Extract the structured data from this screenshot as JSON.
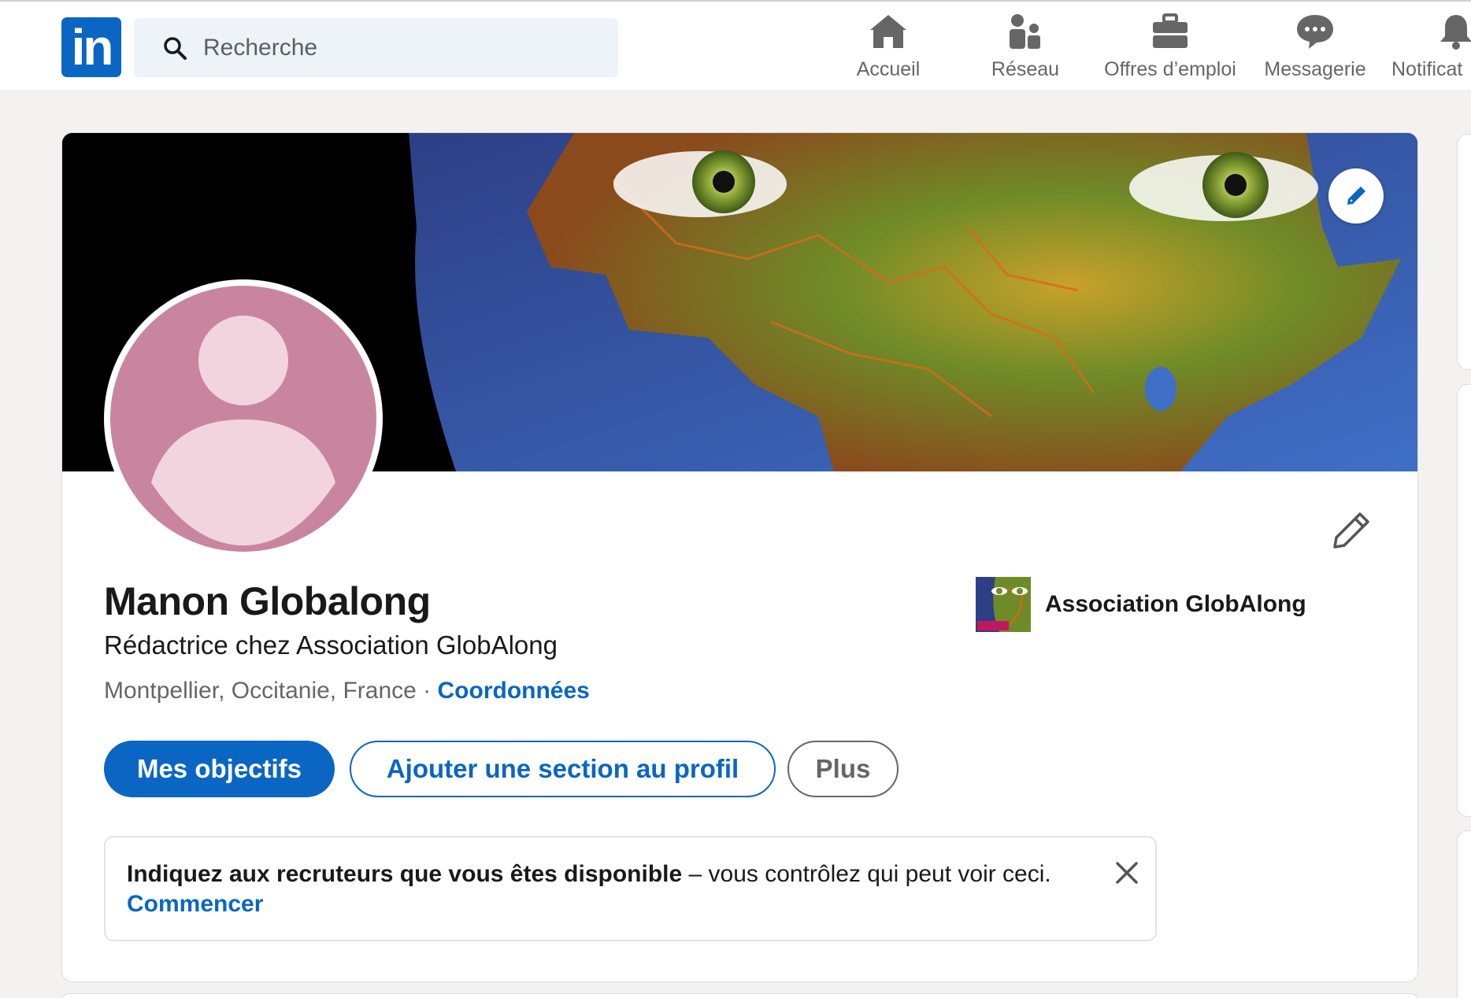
{
  "nav": {
    "logo_text": "in",
    "search": {
      "placeholder": "Recherche"
    },
    "items": [
      {
        "label": "Accueil",
        "icon": "home-icon"
      },
      {
        "label": "Réseau",
        "icon": "network-icon"
      },
      {
        "label": "Offres d’emploi",
        "icon": "briefcase-icon"
      },
      {
        "label": "Messagerie",
        "icon": "chat-bubble-icon"
      },
      {
        "label": "Notificat",
        "icon": "bell-icon"
      }
    ]
  },
  "profile": {
    "name": "Manon Globalong",
    "headline": "Rédactrice chez Association GlobAlong",
    "location": "Montpellier, Occitanie, France",
    "separator": " · ",
    "contact_link": "Coordonnées",
    "organization": "Association GlobAlong",
    "buttons": {
      "primary": "Mes objectifs",
      "add_section": "Ajouter une section au profil",
      "more": "Plus"
    },
    "open_to_work": {
      "bold_text": "Indiquez aux recruteurs que vous êtes disponible",
      "text": " – vous contrôlez qui peut voir ceci.",
      "link": "Commencer"
    }
  },
  "colors": {
    "brand_blue": "#0a66c2",
    "avatar_background": "#c9859f",
    "page_background": "#f4f2ee"
  }
}
